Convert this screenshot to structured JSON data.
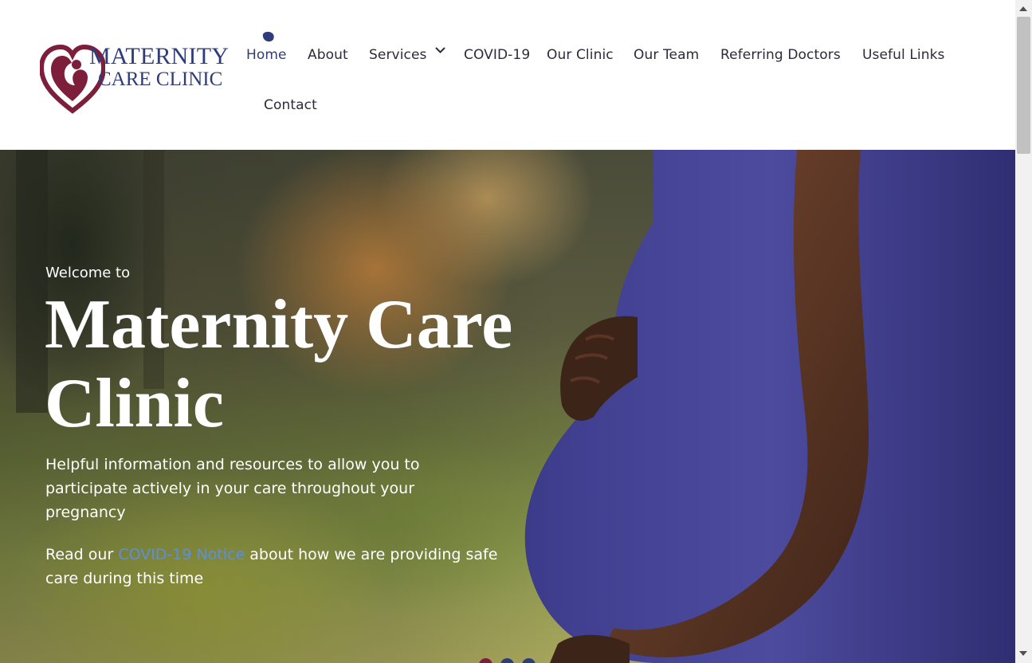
{
  "brand": {
    "name_line1": "MATERNITY",
    "name_line2": "CARE CLINIC",
    "colors": {
      "primary": "#2e3d7a",
      "logo_heart": "#7d1f3a"
    }
  },
  "nav": {
    "items": [
      {
        "label": "Home",
        "active": true
      },
      {
        "label": "About"
      },
      {
        "label": "Services",
        "has_dropdown": true
      },
      {
        "label": "COVID-19"
      },
      {
        "label": "Our Clinic"
      },
      {
        "label": "Our Team"
      },
      {
        "label": "Referring Doctors"
      },
      {
        "label": "Useful Links"
      },
      {
        "label": "Contact"
      }
    ],
    "dropdown_icon": "chevron-down-icon"
  },
  "hero": {
    "welcome": "Welcome to",
    "title": "Maternity Care Clinic",
    "subtitle": "Helpful information and resources to allow you to participate actively in your care throughout your pregnancy",
    "notice_prefix": "Read our ",
    "notice_link": "COVID-19 Notice",
    "notice_suffix": " about how we are providing safe care during this time",
    "link_color": "#5b8fe0",
    "slider_dot_colors": [
      "#7d1f3a",
      "#2e3d7a",
      "#2e3d7a"
    ]
  }
}
